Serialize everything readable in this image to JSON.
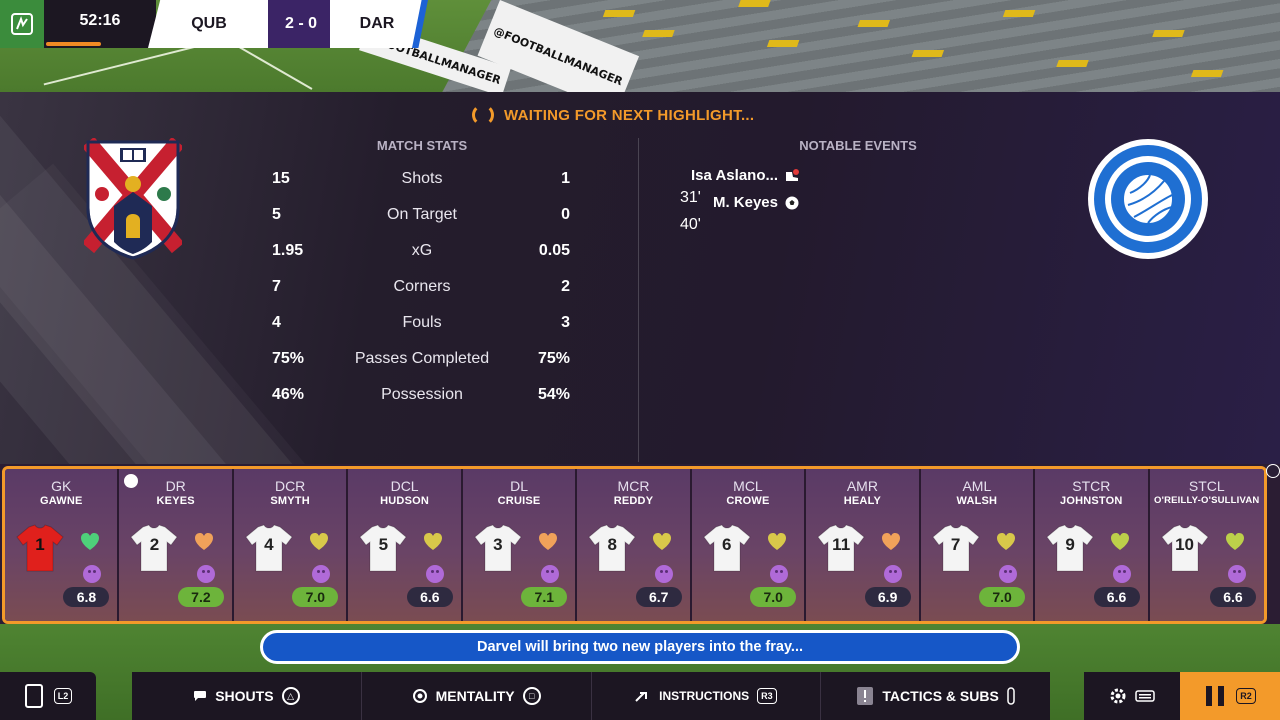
{
  "colors": {
    "accent_orange": "#f39a2a",
    "home_white": "#ffffff",
    "score_bg": "#3b2466",
    "away_blue": "#1f6fd2",
    "rating_good": "#6db43b",
    "commentary_blue": "#1657c7"
  },
  "stadium": {
    "board_1": "@FOOTBALLMANAGER",
    "board_2": "@FOOTBALLMANAGER"
  },
  "scoreboard": {
    "time": "52:16",
    "home": "QUB",
    "score": "2 - 0",
    "away": "DAR",
    "time_progress_percent": 58
  },
  "status": {
    "text": "WAITING FOR NEXT HIGHLIGHT..."
  },
  "stats": {
    "title": "MATCH STATS",
    "rows": [
      {
        "label": "Shots",
        "home": "15",
        "away": "1"
      },
      {
        "label": "On Target",
        "home": "5",
        "away": "0"
      },
      {
        "label": "xG",
        "home": "1.95",
        "away": "0.05"
      },
      {
        "label": "Corners",
        "home": "7",
        "away": "2"
      },
      {
        "label": "Fouls",
        "home": "4",
        "away": "3"
      },
      {
        "label": "Passes Completed",
        "home": "75%",
        "away": "75%"
      },
      {
        "label": "Possession",
        "home": "46%",
        "away": "54%"
      }
    ]
  },
  "events": {
    "title": "NOTABLE EVENTS",
    "items": [
      {
        "player": "Isa Aslano...",
        "minute": "31'",
        "icon": "football-boot-icon"
      },
      {
        "player": "M. Keyes",
        "minute": "40'",
        "icon": "football-icon"
      }
    ]
  },
  "lineup": [
    {
      "pos": "GK",
      "name": "GAWNE",
      "number": "1",
      "rating": "6.8",
      "good": false,
      "heart": "#4ed17a",
      "gk": true
    },
    {
      "pos": "DR",
      "name": "KEYES",
      "number": "2",
      "rating": "7.2",
      "good": true,
      "heart": "#f0a25a",
      "gk": false
    },
    {
      "pos": "DCR",
      "name": "SMYTH",
      "number": "4",
      "rating": "7.0",
      "good": true,
      "heart": "#d8c84a",
      "gk": false
    },
    {
      "pos": "DCL",
      "name": "HUDSON",
      "number": "5",
      "rating": "6.6",
      "good": false,
      "heart": "#d8c84a",
      "gk": false
    },
    {
      "pos": "DL",
      "name": "CRUISE",
      "number": "3",
      "rating": "7.1",
      "good": true,
      "heart": "#f0a25a",
      "gk": false
    },
    {
      "pos": "MCR",
      "name": "REDDY",
      "number": "8",
      "rating": "6.7",
      "good": false,
      "heart": "#d8c84a",
      "gk": false
    },
    {
      "pos": "MCL",
      "name": "CROWE",
      "number": "6",
      "rating": "7.0",
      "good": true,
      "heart": "#d8c84a",
      "gk": false
    },
    {
      "pos": "AMR",
      "name": "HEALY",
      "number": "11",
      "rating": "6.9",
      "good": false,
      "heart": "#f0a25a",
      "gk": false
    },
    {
      "pos": "AML",
      "name": "WALSH",
      "number": "7",
      "rating": "7.0",
      "good": true,
      "heart": "#d8c84a",
      "gk": false
    },
    {
      "pos": "STCR",
      "name": "JOHNSTON",
      "number": "9",
      "rating": "6.6",
      "good": false,
      "heart": "#bcd04a",
      "gk": false
    },
    {
      "pos": "STCL",
      "name": "O'REILLY-O'SULLIVAN",
      "number": "10",
      "rating": "6.6",
      "good": false,
      "heart": "#bcd04a",
      "gk": false
    }
  ],
  "commentary": {
    "text": "Darvel will bring two new players into the fray..."
  },
  "toolbar": {
    "left_badge": "L2",
    "shouts": "SHOUTS",
    "mentality": "MENTALITY",
    "instructions": "INSTRUCTIONS",
    "instructions_badge": "R3",
    "tactics": "TACTICS & SUBS",
    "pause_badge": "R2"
  }
}
